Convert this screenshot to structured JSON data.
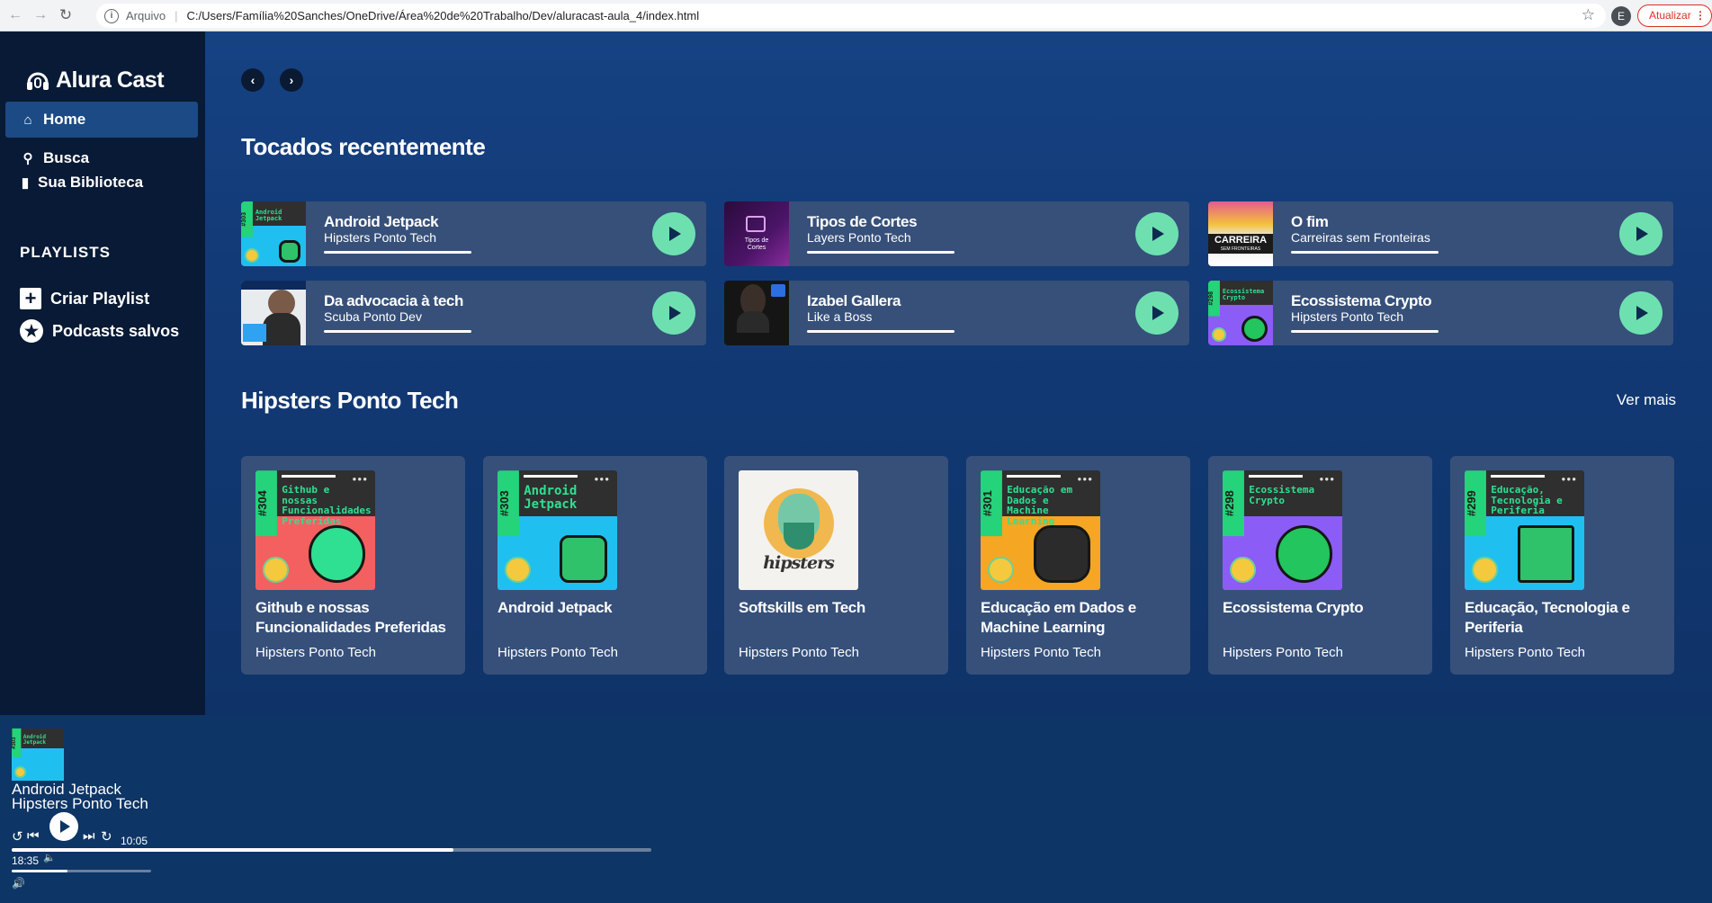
{
  "browser": {
    "scheme_label": "Arquivo",
    "url": "C:/Users/Família%20Sanches/OneDrive/Área%20de%20Trabalho/Dev/aluracast-aula_4/index.html",
    "profile_initial": "E",
    "update_label": "Atualizar"
  },
  "sidebar": {
    "logo": "Alura Cast",
    "nav": [
      {
        "label": "Home",
        "icon": "home-icon"
      },
      {
        "label": "Busca",
        "icon": "search-icon"
      },
      {
        "label": "Sua Biblioteca",
        "icon": "bookmark-icon"
      }
    ],
    "playlists_title": "PLAYLISTS",
    "playlist_items": [
      {
        "label": "Criar Playlist",
        "icon": "plus-icon"
      },
      {
        "label": "Podcasts salvos",
        "icon": "star-icon"
      }
    ]
  },
  "main": {
    "recent_title": "Tocados recentemente",
    "recent": [
      {
        "title": "Android Jetpack",
        "subtitle": "Hipsters Ponto Tech",
        "progress": 0.78
      },
      {
        "title": "Tipos de Cortes",
        "subtitle": "Layers Ponto Tech",
        "progress": 0.78
      },
      {
        "title": "O fim",
        "subtitle": "Carreiras sem Fronteiras",
        "progress": 0.78
      },
      {
        "title": "Da advocacia à tech",
        "subtitle": "Scuba Ponto Dev",
        "progress": 0.78
      },
      {
        "title": "Izabel Gallera",
        "subtitle": "Like a Boss",
        "progress": 0.78
      },
      {
        "title": "Ecossistema Crypto",
        "subtitle": "Hipsters Ponto Tech",
        "progress": 0.78
      }
    ],
    "hipsters_title": "Hipsters Ponto Tech",
    "ver_mais": "Ver mais",
    "podcasts": [
      {
        "title": "Github e nossas Funcionalidades Preferidas",
        "subtitle": "Hipsters Ponto Tech",
        "cover_num": "#304",
        "cover_text": "Github e nossas Funcionalidades Preferidas",
        "color": "#f4605f"
      },
      {
        "title": "Android Jetpack",
        "subtitle": "Hipsters Ponto Tech",
        "cover_num": "#303",
        "cover_text": "Android Jetpack",
        "color": "#1fc0ef"
      },
      {
        "title": "Softskills em Tech",
        "subtitle": "Hipsters Ponto Tech",
        "cover_word": "hipsters"
      },
      {
        "title": "Educação em Dados e Machine Learning",
        "subtitle": "Hipsters Ponto Tech",
        "cover_num": "#301",
        "cover_text": "Educação em Dados e Machine Learning",
        "color": "#f5a623"
      },
      {
        "title": "Ecossistema Crypto",
        "subtitle": "Hipsters Ponto Tech",
        "cover_num": "#298",
        "cover_text": "Ecossistema Crypto",
        "color": "#8b5cf6"
      },
      {
        "title": "Educação, Tecnologia e Periferia",
        "subtitle": "Hipsters Ponto Tech",
        "cover_num": "#299",
        "cover_text": "Educação, Tecnologia e Periferia",
        "color": "#1fc0ef"
      }
    ]
  },
  "player": {
    "title": "Android Jetpack",
    "subtitle": "Hipsters Ponto Tech",
    "current_time": "10:05",
    "duration": "18:35",
    "progress": 0.69,
    "volume": 0.4
  }
}
